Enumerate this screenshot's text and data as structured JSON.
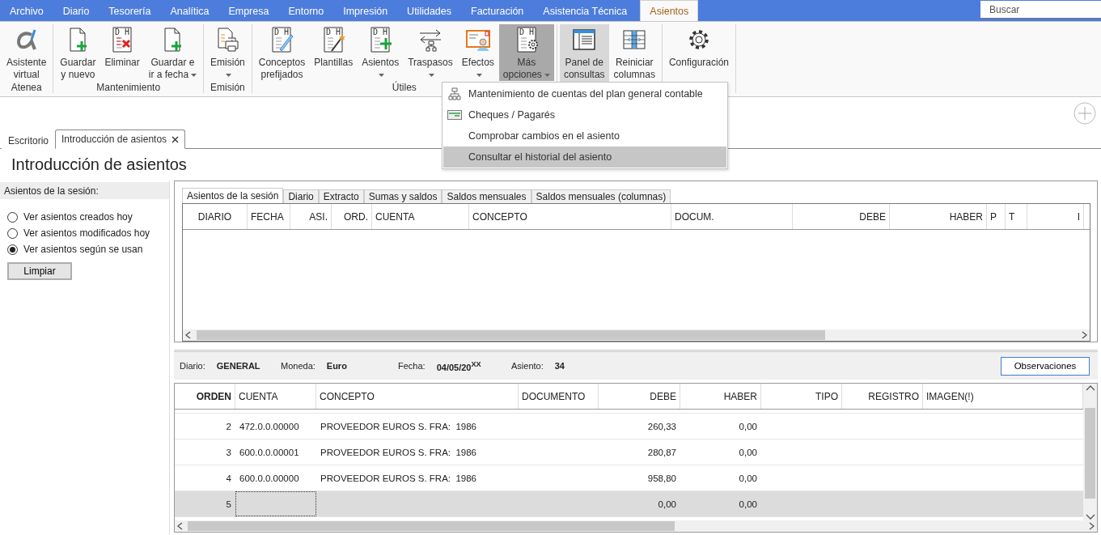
{
  "menu_tabs": [
    {
      "label": "Archivo",
      "selected": false
    },
    {
      "label": "Diario",
      "selected": false
    },
    {
      "label": "Tesorería",
      "selected": false
    },
    {
      "label": "Analítica",
      "selected": false
    },
    {
      "label": "Empresa",
      "selected": false
    },
    {
      "label": "Entorno",
      "selected": false
    },
    {
      "label": "Impresión",
      "selected": false
    },
    {
      "label": "Utilidades",
      "selected": false
    },
    {
      "label": "Facturación",
      "selected": false
    },
    {
      "label": "Asistencia Técnica",
      "selected": false
    },
    {
      "label": "Asientos",
      "selected": true
    }
  ],
  "search": {
    "placeholder": "Buscar"
  },
  "ribbon": {
    "groups": [
      {
        "label": "Atenea",
        "buttons": [
          {
            "kind": "alpha",
            "lines": [
              "Asistente",
              "virtual"
            ],
            "dropdown": false,
            "pressed": false,
            "selected": false
          }
        ]
      },
      {
        "label": "Mantenimiento",
        "buttons": [
          {
            "kind": "doc-plus",
            "lines": [
              "Guardar",
              "y nuevo"
            ],
            "dropdown": false,
            "pressed": false,
            "selected": false
          },
          {
            "kind": "dh-delete",
            "icon_text": "D H",
            "lines": [
              "Eliminar"
            ],
            "dropdown": false,
            "pressed": false,
            "selected": false
          },
          {
            "kind": "doc-plus",
            "lines": [
              "Guardar e",
              "ir a fecha"
            ],
            "dropdown": true,
            "pressed": false,
            "selected": false
          }
        ]
      },
      {
        "label": "Emisión",
        "buttons": [
          {
            "kind": "print",
            "lines": [
              "Emisión"
            ],
            "dropdown": true,
            "pressed": false,
            "selected": false
          }
        ]
      },
      {
        "label": "Útiles",
        "buttons": [
          {
            "kind": "dh-pen",
            "icon_text": "D H",
            "lines": [
              "Conceptos",
              "prefijados"
            ],
            "dropdown": false,
            "pressed": false,
            "selected": false
          },
          {
            "kind": "dh-wand",
            "icon_text": "D H",
            "lines": [
              "Plantillas"
            ],
            "dropdown": false,
            "pressed": false,
            "selected": false
          },
          {
            "kind": "dh-plus",
            "icon_text": "D H",
            "lines": [
              "Asientos"
            ],
            "dropdown": true,
            "pressed": false,
            "selected": false
          },
          {
            "kind": "transfer",
            "lines": [
              "Traspasos"
            ],
            "dropdown": true,
            "pressed": false,
            "selected": false
          },
          {
            "kind": "card",
            "lines": [
              "Efectos"
            ],
            "dropdown": true,
            "pressed": false,
            "selected": false
          },
          {
            "kind": "dh-gear",
            "icon_text": "D H",
            "lines": [
              "Más",
              "opciones"
            ],
            "dropdown": true,
            "pressed": true,
            "selected": false
          }
        ]
      },
      {
        "buttons": [
          {
            "kind": "panel",
            "lines": [
              "Panel de",
              "consultas"
            ],
            "dropdown": false,
            "pressed": false,
            "selected": true
          },
          {
            "kind": "columns",
            "lines": [
              "Reiniciar",
              "columnas"
            ],
            "dropdown": false,
            "pressed": false,
            "selected": false
          }
        ]
      },
      {
        "buttons": [
          {
            "kind": "gear",
            "lines": [
              "Configuración"
            ],
            "dropdown": false,
            "pressed": false,
            "selected": false
          }
        ]
      }
    ]
  },
  "dropdown_menu": {
    "items": [
      {
        "kind": "tree",
        "label": "Mantenimiento de cuentas del plan general contable",
        "selected": false
      },
      {
        "kind": "cheque",
        "label": "Cheques / Pagarés",
        "selected": false
      },
      {
        "kind": "plain",
        "label": "Comprobar cambios en el asiento",
        "selected": false
      },
      {
        "kind": "plain",
        "label": "Consultar el historial del asiento",
        "selected": true
      }
    ]
  },
  "doc_tabs": [
    {
      "label": "Escritorio",
      "selected": false,
      "closable": false
    },
    {
      "label": "Introducción de asientos",
      "selected": true,
      "closable": true
    }
  ],
  "page_title": "Introducción de asientos",
  "session": {
    "header": "Asientos de la sesión:",
    "options": [
      {
        "label": "Ver asientos creados hoy",
        "selected": false
      },
      {
        "label": "Ver asientos modificados hoy",
        "selected": false
      },
      {
        "label": "Ver asientos según se usan",
        "selected": true
      }
    ],
    "clear_button": "Limpiar"
  },
  "query_tabs": [
    {
      "label": "Asientos de la sesión",
      "selected": true
    },
    {
      "label": "Diario",
      "selected": false
    },
    {
      "label": "Extracto",
      "selected": false
    },
    {
      "label": "Sumas y saldos",
      "selected": false
    },
    {
      "label": "Saldos mensuales",
      "selected": false
    },
    {
      "label": "Saldos mensuales (columnas)",
      "selected": false
    }
  ],
  "query_grid": {
    "columns": [
      "DIARIO",
      "FECHA",
      "ASI.",
      "ORD.",
      "CUENTA",
      "CONCEPTO",
      "DOCUM.",
      "DEBE",
      "HABER",
      "P",
      "T",
      "I"
    ]
  },
  "entry_header": {
    "fields": [
      {
        "label": "Diario:",
        "value": "GENERAL"
      },
      {
        "label": "Moneda:",
        "value": "Euro"
      },
      {
        "label": "Fecha:",
        "value": "04/05/20$^{XX}$"
      },
      {
        "label": "Asiento:",
        "value": "34"
      }
    ],
    "button": "Observaciones"
  },
  "entry_grid": {
    "columns": [
      "ORDEN",
      "CUENTA",
      "CONCEPTO",
      "DOCUMENTO",
      "DEBE",
      "HABER",
      "TIPO",
      "REGISTRO",
      "IMAGEN(!)"
    ],
    "rows": [
      {
        "orden": "2",
        "cuenta": "472.0.0.00000",
        "concepto": "PROVEEDOR EUROS S. FRA:  1986",
        "debe": "260,33",
        "haber": "0,00",
        "selected": false
      },
      {
        "orden": "3",
        "cuenta": "600.0.0.00001",
        "concepto": "PROVEEDOR EUROS S. FRA:  1986",
        "debe": "280,87",
        "haber": "0,00",
        "selected": false
      },
      {
        "orden": "4",
        "cuenta": "600.0.0.00000",
        "concepto": "PROVEEDOR EUROS S. FRA:  1986",
        "debe": "958,80",
        "haber": "0,00",
        "selected": false
      },
      {
        "orden": "5",
        "debe": "0,00",
        "haber": "0,00",
        "selected": true
      }
    ]
  }
}
